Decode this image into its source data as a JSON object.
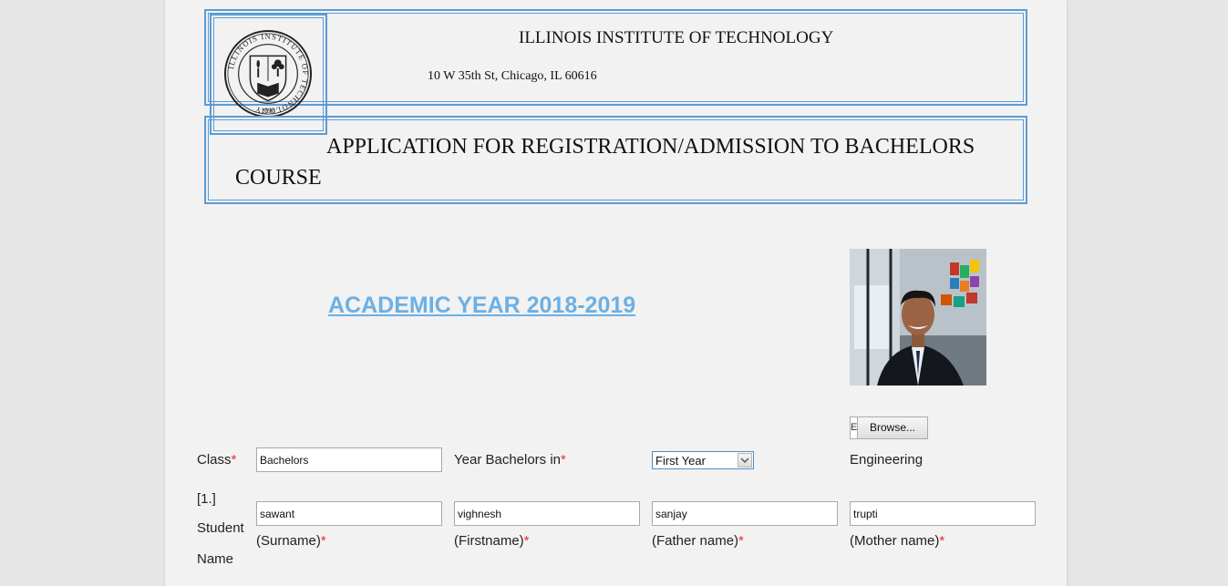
{
  "header": {
    "institute_name": "ILLINOIS INSTITUTE OF TECHNOLOGY",
    "address": "10 W 35th St, Chicago, IL 60616",
    "seal_text_top": "ILLINOIS INSTITUTE OF TECHNOLOGY",
    "seal_year": "1890"
  },
  "title": {
    "line1": "APPLICATION FOR REGISTRATION/ADMISSION TO BACHELORS",
    "line2": "COURSE"
  },
  "academic_year": "ACADEMIC YEAR 2018-2019",
  "photo": {
    "browse_label": "Browse...",
    "file_stub": "E"
  },
  "form": {
    "required_marker": "*",
    "class": {
      "label": "Class",
      "value": "Bachelors"
    },
    "year": {
      "label": "Year Bachelors in",
      "selected": "First Year"
    },
    "branch_text": "Engineering",
    "student_name": {
      "number": "[1.]",
      "label_line1": "Student",
      "label_line2": "Name",
      "surname": {
        "value": "sawant",
        "caption": "(Surname)"
      },
      "firstname": {
        "value": "vighnesh",
        "caption": "(Firstname)"
      },
      "father": {
        "value": "sanjay",
        "caption": "(Father name)"
      },
      "mother": {
        "value": "trupti",
        "caption": "(Mother name)"
      }
    }
  },
  "colors": {
    "border_blue": "#5b9bd5",
    "link_blue": "#6cb0e4",
    "required_red": "#e03030",
    "page_bg": "#f2f2f2"
  }
}
